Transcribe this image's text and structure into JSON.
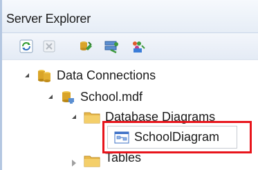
{
  "window": {
    "title": "Server Explorer"
  },
  "toolbar": {
    "buttons": [
      {
        "name": "refresh-icon"
      },
      {
        "name": "stop-refresh-icon"
      },
      {
        "name": "connect-to-database-icon"
      },
      {
        "name": "connect-to-server-icon"
      },
      {
        "name": "connect-to-sharepoint-icon"
      }
    ]
  },
  "tree": {
    "data_connections": "Data Connections",
    "database_file": "School.mdf",
    "database_diagrams": "Database Diagrams",
    "diagram_item": "SchoolDiagram",
    "tables": "Tables"
  },
  "colors": {
    "highlight_border": "#e8141b",
    "folder": "#e8b84a"
  }
}
